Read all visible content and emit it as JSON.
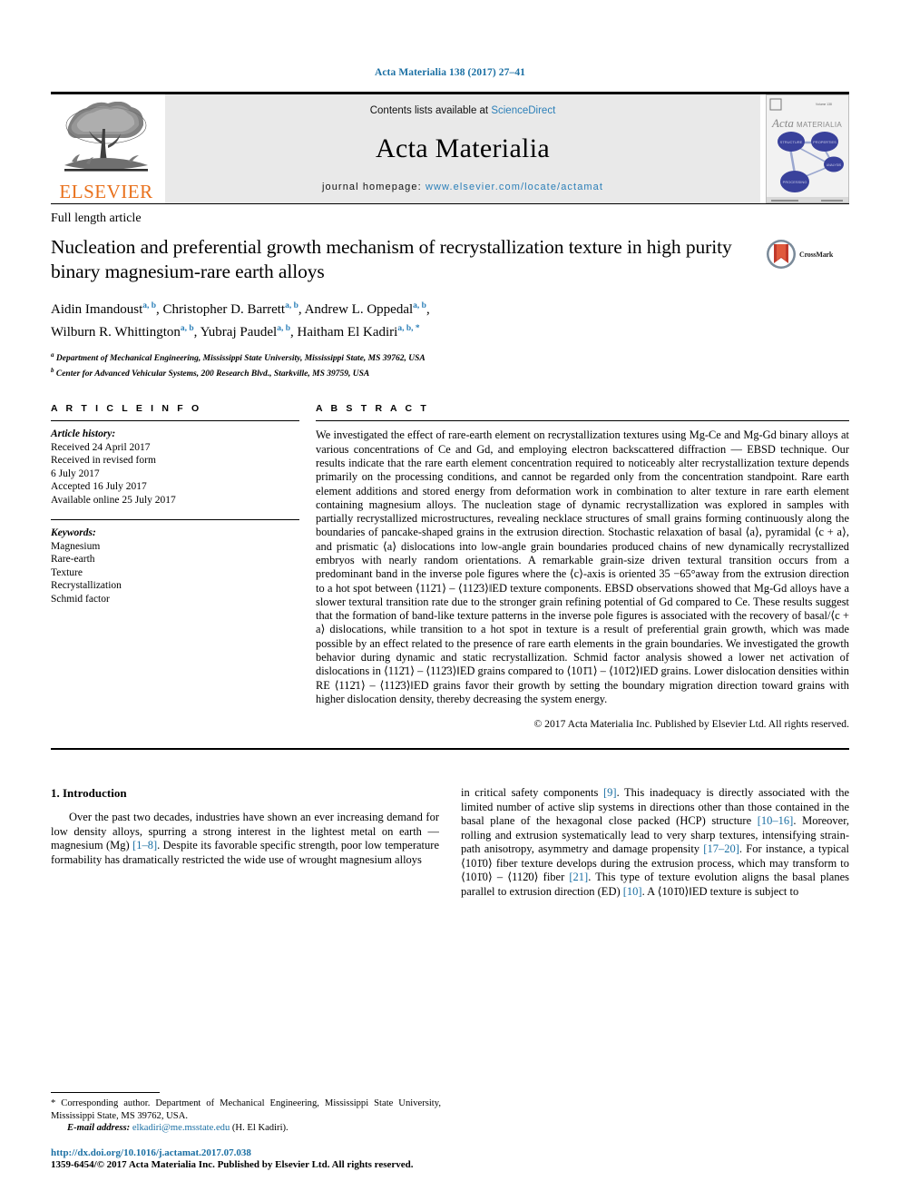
{
  "running_head": "Acta Materialia 138 (2017) 27–41",
  "masthead": {
    "contents_prefix": "Contents lists available at ",
    "sciencedirect": "ScienceDirect",
    "journal_title": "Acta Materialia",
    "homepage_prefix": "journal homepage: ",
    "homepage_url": "www.elsevier.com/locate/actamat",
    "publisher_logo_text": "ELSEVIER",
    "cover_title_acta": "Acta",
    "cover_title_materialia": "MATERIALIA",
    "cover_nodes": [
      "STRUCTURE",
      "PROPERTIES",
      "ANALYSIS",
      "PROCESSING"
    ],
    "accent_link_color": "#2b7fb8",
    "elsevier_orange": "#E9711C"
  },
  "article": {
    "type": "Full length article",
    "title": "Nucleation and preferential growth mechanism of recrystallization texture in high purity binary magnesium-rare earth alloys",
    "crossmark_label": "CrossMark",
    "authors_line1": "Aidin Imandoust",
    "authors": [
      {
        "name": "Aidin Imandoust",
        "marks": "a, b",
        "sep": ", "
      },
      {
        "name": "Christopher D. Barrett",
        "marks": "a, b",
        "sep": ", "
      },
      {
        "name": "Andrew L. Oppedal",
        "marks": "a, b",
        "sep": ", "
      },
      {
        "name": "Wilburn R. Whittington",
        "marks": "a, b",
        "sep": ", "
      },
      {
        "name": "Yubraj Paudel",
        "marks": "a, b",
        "sep": ", "
      },
      {
        "name": "Haitham El Kadiri",
        "marks": "a, b, *",
        "sep": ""
      }
    ],
    "affiliations": [
      {
        "mark": "a",
        "text": "Department of Mechanical Engineering, Mississippi State University, Mississippi State, MS 39762, USA"
      },
      {
        "mark": "b",
        "text": "Center for Advanced Vehicular Systems, 200 Research Blvd., Starkville, MS 39759, USA"
      }
    ]
  },
  "info": {
    "heading": "A R T I C L E  I N F O",
    "history_label": "Article history:",
    "history": [
      "Received 24 April 2017",
      "Received in revised form",
      "6 July 2017",
      "Accepted 16 July 2017",
      "Available online 25 July 2017"
    ],
    "keywords_label": "Keywords:",
    "keywords": [
      "Magnesium",
      "Rare-earth",
      "Texture",
      "Recrystallization",
      "Schmid factor"
    ]
  },
  "abstract": {
    "heading": "A B S T R A C T",
    "text_part1": "We investigated the effect of rare-earth element on recrystallization textures using Mg-Ce and Mg-Gd binary alloys at various concentrations of Ce and Gd, and employing electron backscattered diffraction — EBSD technique. Our results indicate that the rare earth element concentration required to noticeably alter recrystallization texture depends primarily on the processing conditions, and cannot be regarded only from the concentration standpoint. Rare earth element additions and stored energy from deformation work in combination to alter texture in rare earth element containing magnesium alloys. The nucleation stage of dynamic recrystallization was explored in samples with partially recrystallized microstructures, revealing necklace structures of small grains forming continuously along the boundaries of pancake-shaped grains in the extrusion direction. Stochastic relaxation of basal ⟨a⟩, pyramidal ⟨c + a⟩, and prismatic ⟨a⟩ dislocations into low-angle grain boundaries produced chains of new dynamically recrystallized embryos with nearly random orientations. A remarkable grain-size driven textural transition occurs from a predominant band in the inverse pole figures where the ⟨c⟩-axis is oriented 35 −65°away from the extrusion direction to a hot spot between ⟨112̄1⟩ – ⟨112̄3⟩‖ED texture components. EBSD observations showed that Mg-Gd alloys have a slower textural transition rate due to the stronger grain refining potential of Gd compared to Ce. These results suggest that the formation of band-like texture patterns in the inverse pole figures is associated with the recovery of basal/⟨c + a⟩ dislocations, while transition to a hot spot in texture is a result of preferential grain growth, which was made possible by an effect related to the presence of rare earth elements in the grain boundaries. We investigated the growth behavior during dynamic and static recrystallization. Schmid factor analysis showed a lower net activation of dislocations in ⟨112̄1⟩ – ⟨112̄3⟩‖ED grains compared to ⟨101̄1⟩ – ⟨101̄2⟩‖ED grains. Lower dislocation densities within RE ⟨112̄1⟩ – ⟨112̄3⟩‖ED grains favor their growth by setting the boundary migration direction toward grains with higher dislocation density, thereby decreasing the system energy.",
    "copyright": "© 2017 Acta Materialia Inc. Published by Elsevier Ltd. All rights reserved."
  },
  "body": {
    "section_number_title": "1. Introduction",
    "left_paragraph": "Over the past two decades, industries have shown an ever increasing demand for low density alloys, spurring a strong interest in the lightest metal on earth — magnesium (Mg) [1–8]. Despite its favorable specific strength, poor low temperature formability has dramatically restricted the wide use of wrought magnesium alloys",
    "left_refs": [
      "[1–8]"
    ],
    "right_paragraph": "in critical safety components [9]. This inadequacy is directly associated with the limited number of active slip systems in directions other than those contained in the basal plane of the hexagonal close packed (HCP) structure [10–16]. Moreover, rolling and extrusion systematically lead to very sharp textures, intensifying strain-path anisotropy, asymmetry and damage propensity [17–20]. For instance, a typical ⟨101̄0⟩ fiber texture develops during the extrusion process, which may transform to ⟨101̄0⟩ – ⟨112̄0⟩ fiber [21]. This type of texture evolution aligns the basal planes parallel to extrusion direction (ED) [10]. A ⟨101̄0⟩‖ED texture is subject to",
    "right_refs": [
      "[9]",
      "[10–16]",
      "[17–20]",
      "[21]",
      "[10]"
    ]
  },
  "footnotes": {
    "corresponding_marker": "*",
    "corresponding_text": "Corresponding author. Department of Mechanical Engineering, Mississippi State University, Mississippi State, MS 39762, USA.",
    "email_label": "E-mail address:",
    "email": "elkadiri@me.msstate.edu",
    "email_owner": "(H. El Kadiri).",
    "doi_url": "http://dx.doi.org/10.1016/j.actamat.2017.07.038",
    "issn_line": "1359-6454/© 2017 Acta Materialia Inc. Published by Elsevier Ltd. All rights reserved."
  }
}
